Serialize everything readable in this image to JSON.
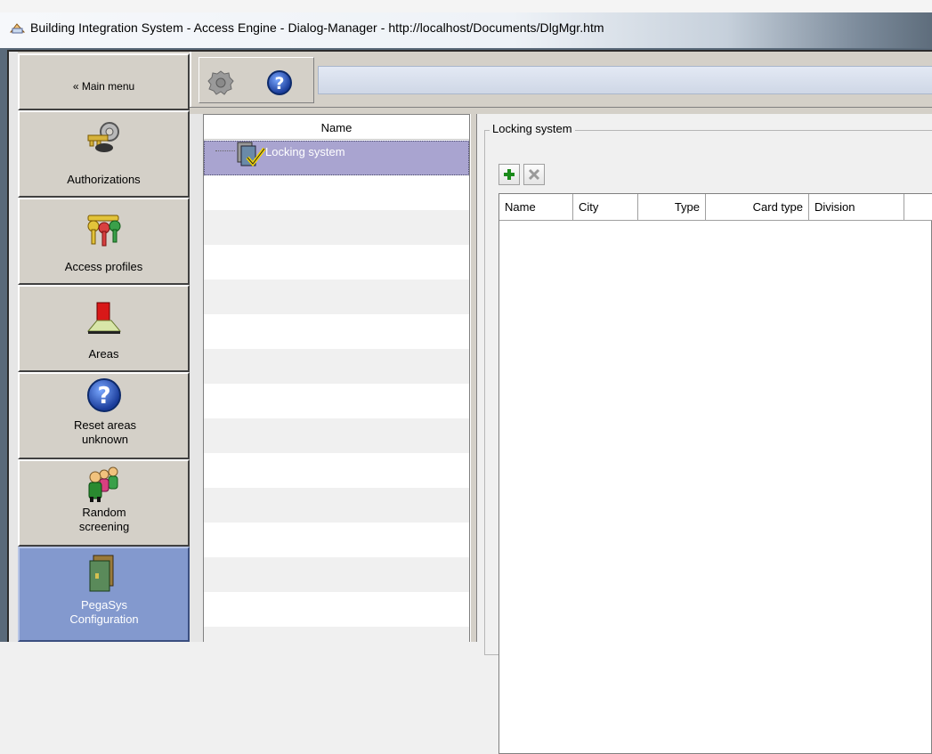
{
  "window": {
    "title": "Building Integration System - Access Engine - Dialog-Manager - http://localhost/Documents/DlgMgr.htm"
  },
  "sidebar": {
    "main_menu": "« Main menu",
    "items": [
      {
        "label": "Authorizations",
        "icon": "keys-icon"
      },
      {
        "label": "Access profiles",
        "icon": "colored-keys-icon"
      },
      {
        "label": "Areas",
        "icon": "area-marker-icon"
      },
      {
        "label": "Reset areas unknown",
        "icon": "help-icon"
      },
      {
        "label": "Random screening",
        "icon": "people-icon"
      },
      {
        "label": "PegaSys Configuration",
        "icon": "doors-icon"
      }
    ]
  },
  "toolbar": {
    "buttons": [
      {
        "name": "gear-icon"
      },
      {
        "name": "help-icon"
      }
    ]
  },
  "tree": {
    "header": "Name",
    "selected_item": "Locking system"
  },
  "detail": {
    "group_title": "Locking system",
    "columns": [
      "Name",
      "City",
      "Type",
      "Card type",
      "Division"
    ]
  },
  "colors": {
    "active_sidebar": "#8399ce",
    "selected_row": "#a9a4d0"
  }
}
